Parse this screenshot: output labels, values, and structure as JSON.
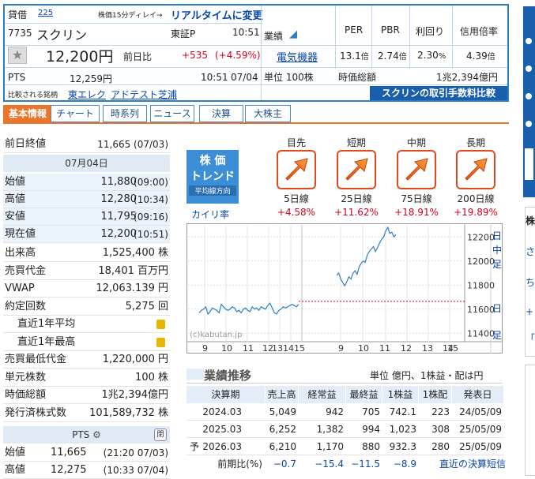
{
  "header": {
    "loan_label": "貸借",
    "loan_number": "225",
    "delay_note": "株価15分ディレイ→",
    "realtime_link": "リアルタイムに変更",
    "code": "7735",
    "name": "スクリン",
    "market": "東証P",
    "time": "10:51",
    "price": "12,200円",
    "prev_day_label": "前日比",
    "change": "+535",
    "change_pct": "(+4.59%)",
    "pts_label": "PTS",
    "pts_price": "12,259円",
    "pts_time": "10:51",
    "pts_date": "07/04",
    "compare_label": "比較される銘柄",
    "compare_items": [
      "東エレク",
      "アドテスト",
      "芝浦"
    ],
    "sector_label": "業績",
    "sector_link": "電気機器",
    "unit_label": "単位 100株",
    "per_label": "PER",
    "pbr_label": "PBR",
    "yield_label": "利回り",
    "margin_label": "信用倍率",
    "per_value": "13.1",
    "per_unit": "倍",
    "pbr_value": "2.74",
    "pbr_unit": "倍",
    "yield_value": "2.30",
    "yield_unit": "%",
    "margin_value": "4.39",
    "margin_unit": "倍",
    "mcap_label": "時価総額",
    "mcap_value": "1兆2,394億円",
    "fee_banner": "スクリンの取引手数料比較"
  },
  "tabs": [
    "基本情報",
    "チャート",
    "時系列",
    "ニュース",
    "決算",
    "大株主"
  ],
  "left": {
    "prev_close_label": "前日終値",
    "prev_close_value": "11,665 (07/03)",
    "date_head": "07月04日",
    "ohlc": [
      {
        "label": "始値",
        "value": "11,880",
        "time": "(09:00)"
      },
      {
        "label": "高値",
        "value": "12,280",
        "time": "(10:34)"
      },
      {
        "label": "安値",
        "value": "11,795",
        "time": "(09:16)"
      },
      {
        "label": "現在値",
        "value": "12,200",
        "time": "(10:51)"
      }
    ],
    "stats": [
      {
        "label": "出来高",
        "value": "1,525,400 株"
      },
      {
        "label": "売買代金",
        "value": "18,401 百万円"
      },
      {
        "label": "VWAP",
        "value": "12,063.139 円"
      },
      {
        "label": "約定回数",
        "value": "5,275 回"
      },
      {
        "label": "直近1年平均",
        "value": ""
      },
      {
        "label": "直近1年最高",
        "value": ""
      },
      {
        "label": "売買最低代金",
        "value": "1,220,000 円"
      },
      {
        "label": "単元株数",
        "value": "100 株"
      },
      {
        "label": "時価総額",
        "value": "1兆2,394億円"
      },
      {
        "label": "発行済株式数",
        "value": "101,589,732 株"
      }
    ],
    "pts_head": "PTS",
    "pts_close": "閉",
    "pts_rows": [
      {
        "label": "始値",
        "value": "11,665",
        "time": "(21:20  07/03)"
      },
      {
        "label": "高値",
        "value": "12,275",
        "time": "(10:33  07/04)"
      }
    ]
  },
  "trend": {
    "title1": "株 価",
    "title2": "トレンド",
    "title3": "平均線方向",
    "kairi_label": "カイリ率",
    "columns": [
      {
        "period": "目先",
        "line": "5日線",
        "kairi": "+4.58%"
      },
      {
        "period": "短期",
        "line": "25日線",
        "kairi": "+11.62%"
      },
      {
        "period": "中期",
        "line": "75日線",
        "kairi": "+18.91%"
      },
      {
        "period": "長期",
        "line": "200日線",
        "kairi": "+19.89%"
      }
    ]
  },
  "chart_data": {
    "type": "line",
    "watermark": "(c)kabutan.jp",
    "x_ticks": [
      "9",
      "10",
      "11",
      "12",
      "13",
      "14",
      "15",
      "9",
      "10",
      "11",
      "12",
      "13",
      "14",
      "15"
    ],
    "y_ticks": [
      12200,
      12000,
      11800,
      11600,
      11400
    ],
    "ylim": [
      11330,
      12300
    ],
    "prev_close": 11665,
    "side_labels": [
      "日",
      "中",
      "足",
      "日",
      "足"
    ],
    "day1": [
      11570,
      11590,
      11600,
      11620,
      11560,
      11580,
      11610,
      11600,
      11590,
      11570,
      11640,
      11620,
      11600,
      11590,
      11600,
      11620,
      11610,
      11580,
      11590,
      11570,
      11600,
      11610,
      11590,
      11580,
      11620,
      11600,
      11610,
      11590,
      11620,
      11610,
      11600,
      11630,
      11650,
      11610,
      11570,
      11560,
      11590,
      11600,
      11620,
      11610,
      11620,
      11630,
      11640,
      11630,
      11620,
      11640
    ],
    "day2": [
      11880,
      11900,
      11850,
      11820,
      11795,
      11830,
      11870,
      11850,
      11900,
      11920,
      11890,
      11950,
      11980,
      12000,
      11990,
      12050,
      12080,
      12100,
      12120,
      12080,
      12110,
      12150,
      12180,
      12200,
      12250,
      12280,
      12230,
      12240,
      12200,
      12220
    ]
  },
  "results": {
    "title": "業績推移",
    "unit": "単位 億円、1株益・配は円",
    "headers": [
      "決算期",
      "売上高",
      "経常益",
      "最終益",
      "1株益",
      "1株配",
      "発表日"
    ],
    "rows": [
      [
        "2024.03",
        "5,049",
        "942",
        "705",
        "742.1",
        "223",
        "24/05/09"
      ],
      [
        "2025.03",
        "6,252",
        "1,382",
        "994",
        "1,023",
        "308",
        "25/05/09"
      ],
      [
        "2026.03",
        "6,210",
        "1,170",
        "880",
        "932.3",
        "280",
        "25/05/09"
      ]
    ],
    "forecast_mark": "予",
    "yoy_label": "前期比(%)",
    "yoy": [
      "−0.7",
      "−15.4",
      "−11.5",
      "−8.9"
    ],
    "recent_link": "直近の決算短信"
  },
  "right_panel": {
    "head": "株",
    "items": [
      "さ",
      "ち",
      "+",
      "「"
    ]
  }
}
